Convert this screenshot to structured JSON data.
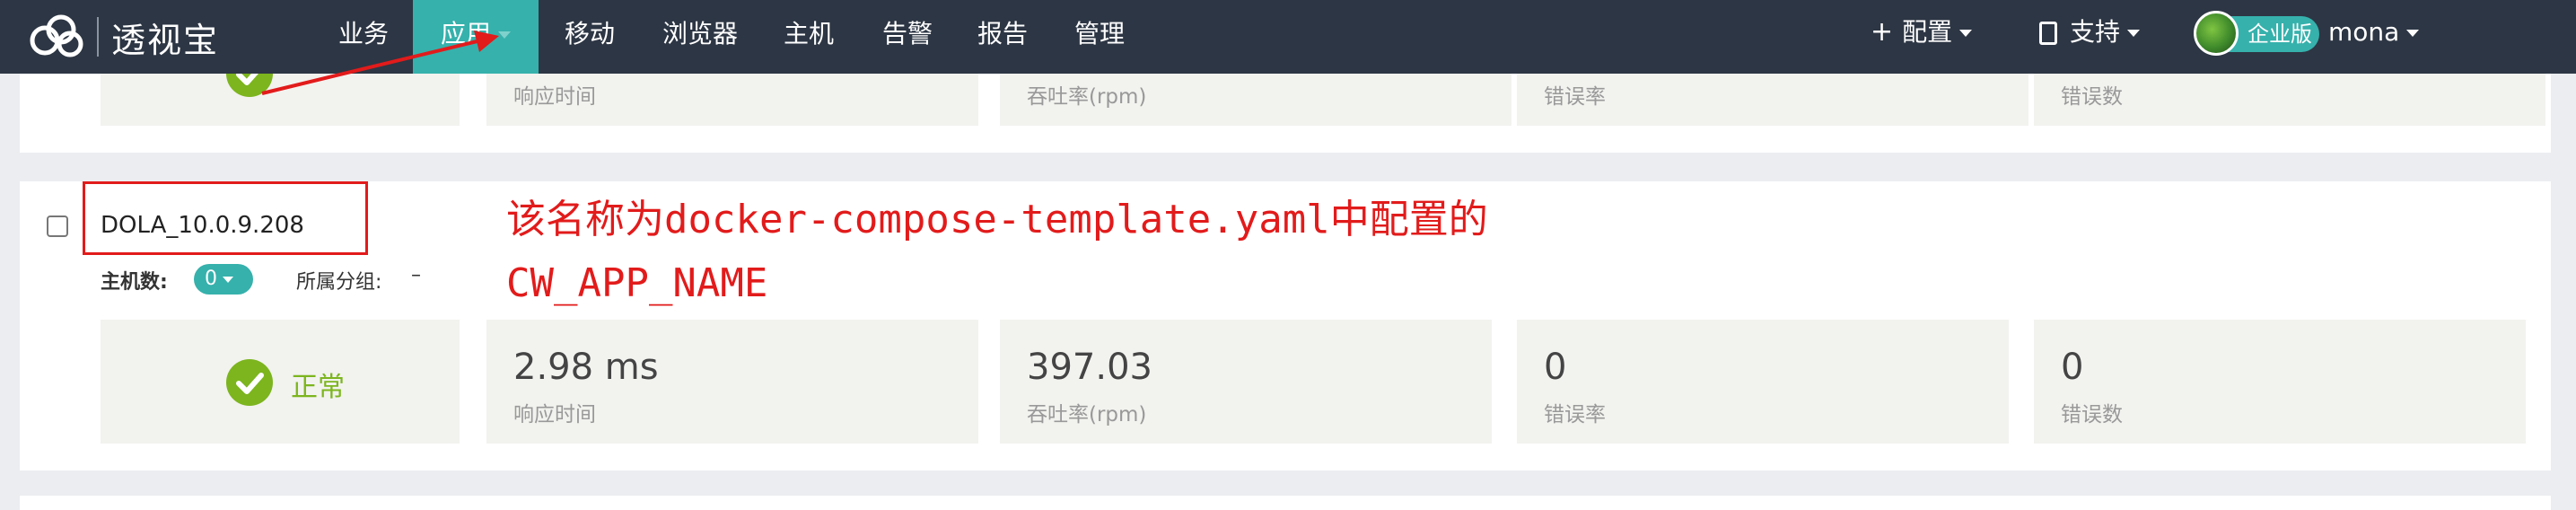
{
  "header": {
    "logo_text": "透视宝",
    "nav": [
      {
        "label": "业务",
        "active": false
      },
      {
        "label": "应用",
        "active": true
      },
      {
        "label": "移动",
        "active": false
      },
      {
        "label": "浏览器",
        "active": false
      },
      {
        "label": "主机",
        "active": false
      },
      {
        "label": "告警",
        "active": false
      },
      {
        "label": "报告",
        "active": false
      },
      {
        "label": "管理",
        "active": false
      }
    ],
    "config_label": "配置",
    "support_label": "支持",
    "edition_badge": "企业版",
    "username": "mona"
  },
  "top_app": {
    "metrics": [
      {
        "label": "响应时间"
      },
      {
        "label": "吞吐率(rpm)"
      },
      {
        "label": "错误率"
      },
      {
        "label": "错误数"
      }
    ]
  },
  "app": {
    "name": "DOLA_10.0.9.208",
    "host_count_label": "主机数:",
    "host_count": "0",
    "group_label": "所属分组:",
    "group_value": "–",
    "status": "正常",
    "metrics": [
      {
        "value": "2.98 ms",
        "label": "响应时间"
      },
      {
        "value": "397.03",
        "label": "吞吐率(rpm)"
      },
      {
        "value": "0",
        "label": "错误率"
      },
      {
        "value": "0",
        "label": "错误数"
      }
    ]
  },
  "annotation": {
    "line1": "该名称为docker-compose-template.yaml中配置的",
    "line2": "CW_APP_NAME"
  },
  "colors": {
    "nav_bg": "#2d3644",
    "accent": "#36b1ac",
    "status_ok": "#7cb51e",
    "annotation_red": "#e21b1b"
  }
}
